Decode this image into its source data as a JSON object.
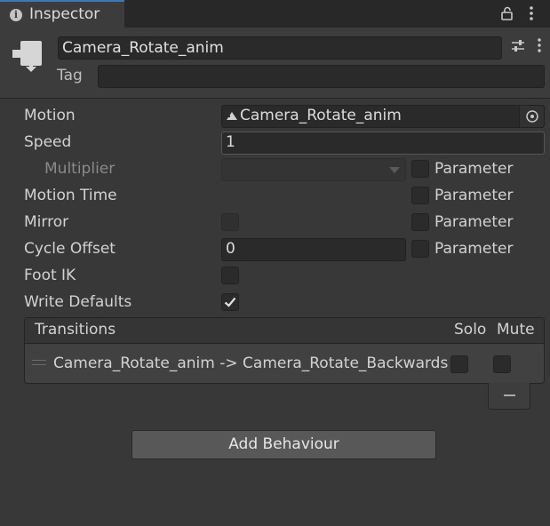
{
  "tab": {
    "title": "Inspector",
    "info_icon": "info-icon"
  },
  "toolbar": {
    "lock_icon": "lock-icon",
    "menu_icon": "kebab-menu-icon"
  },
  "header": {
    "object_icon": "animator-state-icon",
    "name": "Camera_Rotate_anim",
    "tag_label": "Tag",
    "tag_value": "",
    "preset_icon": "presets-icon",
    "menu_icon": "kebab-menu-icon"
  },
  "properties": {
    "motion": {
      "label": "Motion",
      "value": "Camera_Rotate_anim",
      "icon": "animation-clip-icon"
    },
    "speed": {
      "label": "Speed",
      "value": "1"
    },
    "multiplier": {
      "label": "Multiplier",
      "value": "",
      "parameter_label": "Parameter",
      "parameter_checked": false
    },
    "motion_time": {
      "label": "Motion Time",
      "parameter_label": "Parameter",
      "parameter_checked": false
    },
    "mirror": {
      "label": "Mirror",
      "checked": false,
      "parameter_label": "Parameter",
      "parameter_checked": false
    },
    "cycle_offset": {
      "label": "Cycle Offset",
      "value": "0",
      "parameter_label": "Parameter",
      "parameter_checked": false
    },
    "foot_ik": {
      "label": "Foot IK",
      "checked": false
    },
    "write_defaults": {
      "label": "Write Defaults",
      "checked": true
    }
  },
  "transitions": {
    "title": "Transitions",
    "solo_label": "Solo",
    "mute_label": "Mute",
    "items": [
      {
        "text": "Camera_Rotate_anim -> Camera_Rotate_Backwards",
        "solo": false,
        "mute": false
      }
    ]
  },
  "add_behaviour_label": "Add Behaviour",
  "colors": {
    "background": "#383838",
    "tab_accent": "#3a79bb",
    "field": "#2a2a2a"
  }
}
